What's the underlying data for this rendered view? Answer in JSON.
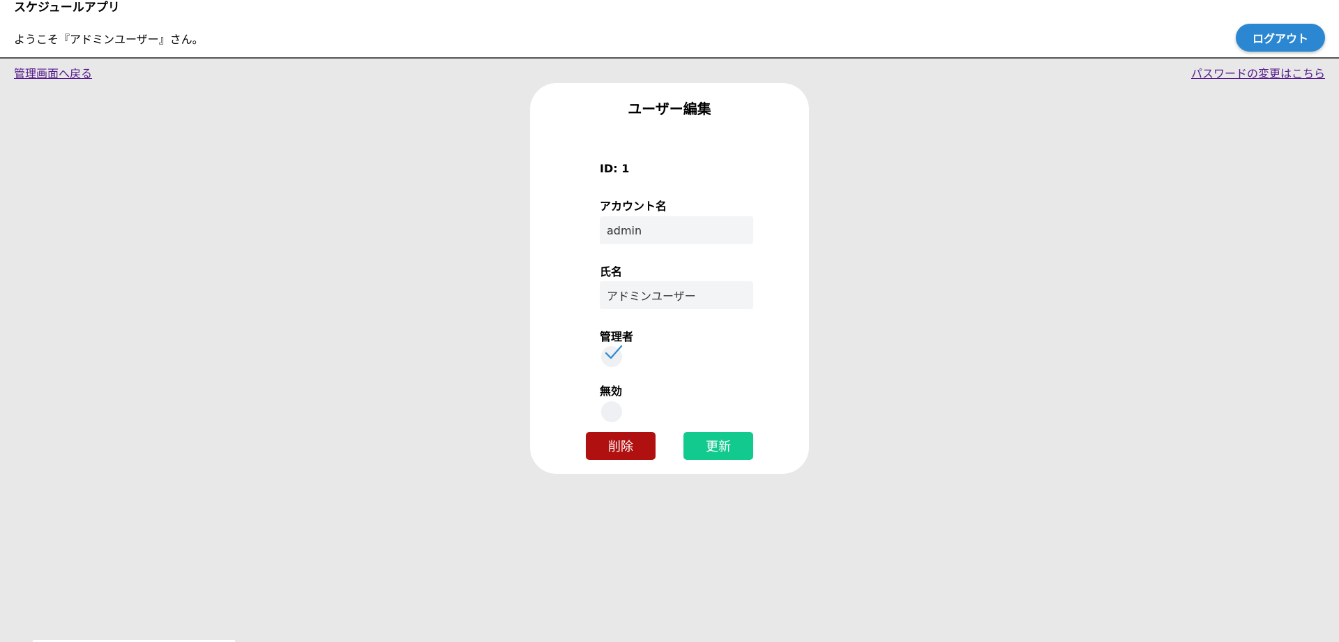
{
  "header": {
    "app_title": "スケジュールアプリ",
    "welcome": "ようこそ『アドミンユーザー』さん。",
    "logout_label": "ログアウト"
  },
  "nav": {
    "back_label": "管理画面へ戻る",
    "password_label": "パスワードの変更はこちら"
  },
  "form": {
    "title": "ユーザー編集",
    "id_label": "ID: 1",
    "account_label": "アカウント名",
    "account_value": "admin",
    "name_label": "氏名",
    "name_value": "アドミンユーザー",
    "admin_label": "管理者",
    "admin_checked": true,
    "disabled_label": "無効",
    "disabled_checked": false,
    "delete_label": "削除",
    "update_label": "更新"
  },
  "colors": {
    "background": "#e8e8e8",
    "logout": "#2b87d1",
    "delete": "#b01010",
    "update": "#12c98e",
    "link": "#551a8b",
    "check": "#2b87d1"
  }
}
